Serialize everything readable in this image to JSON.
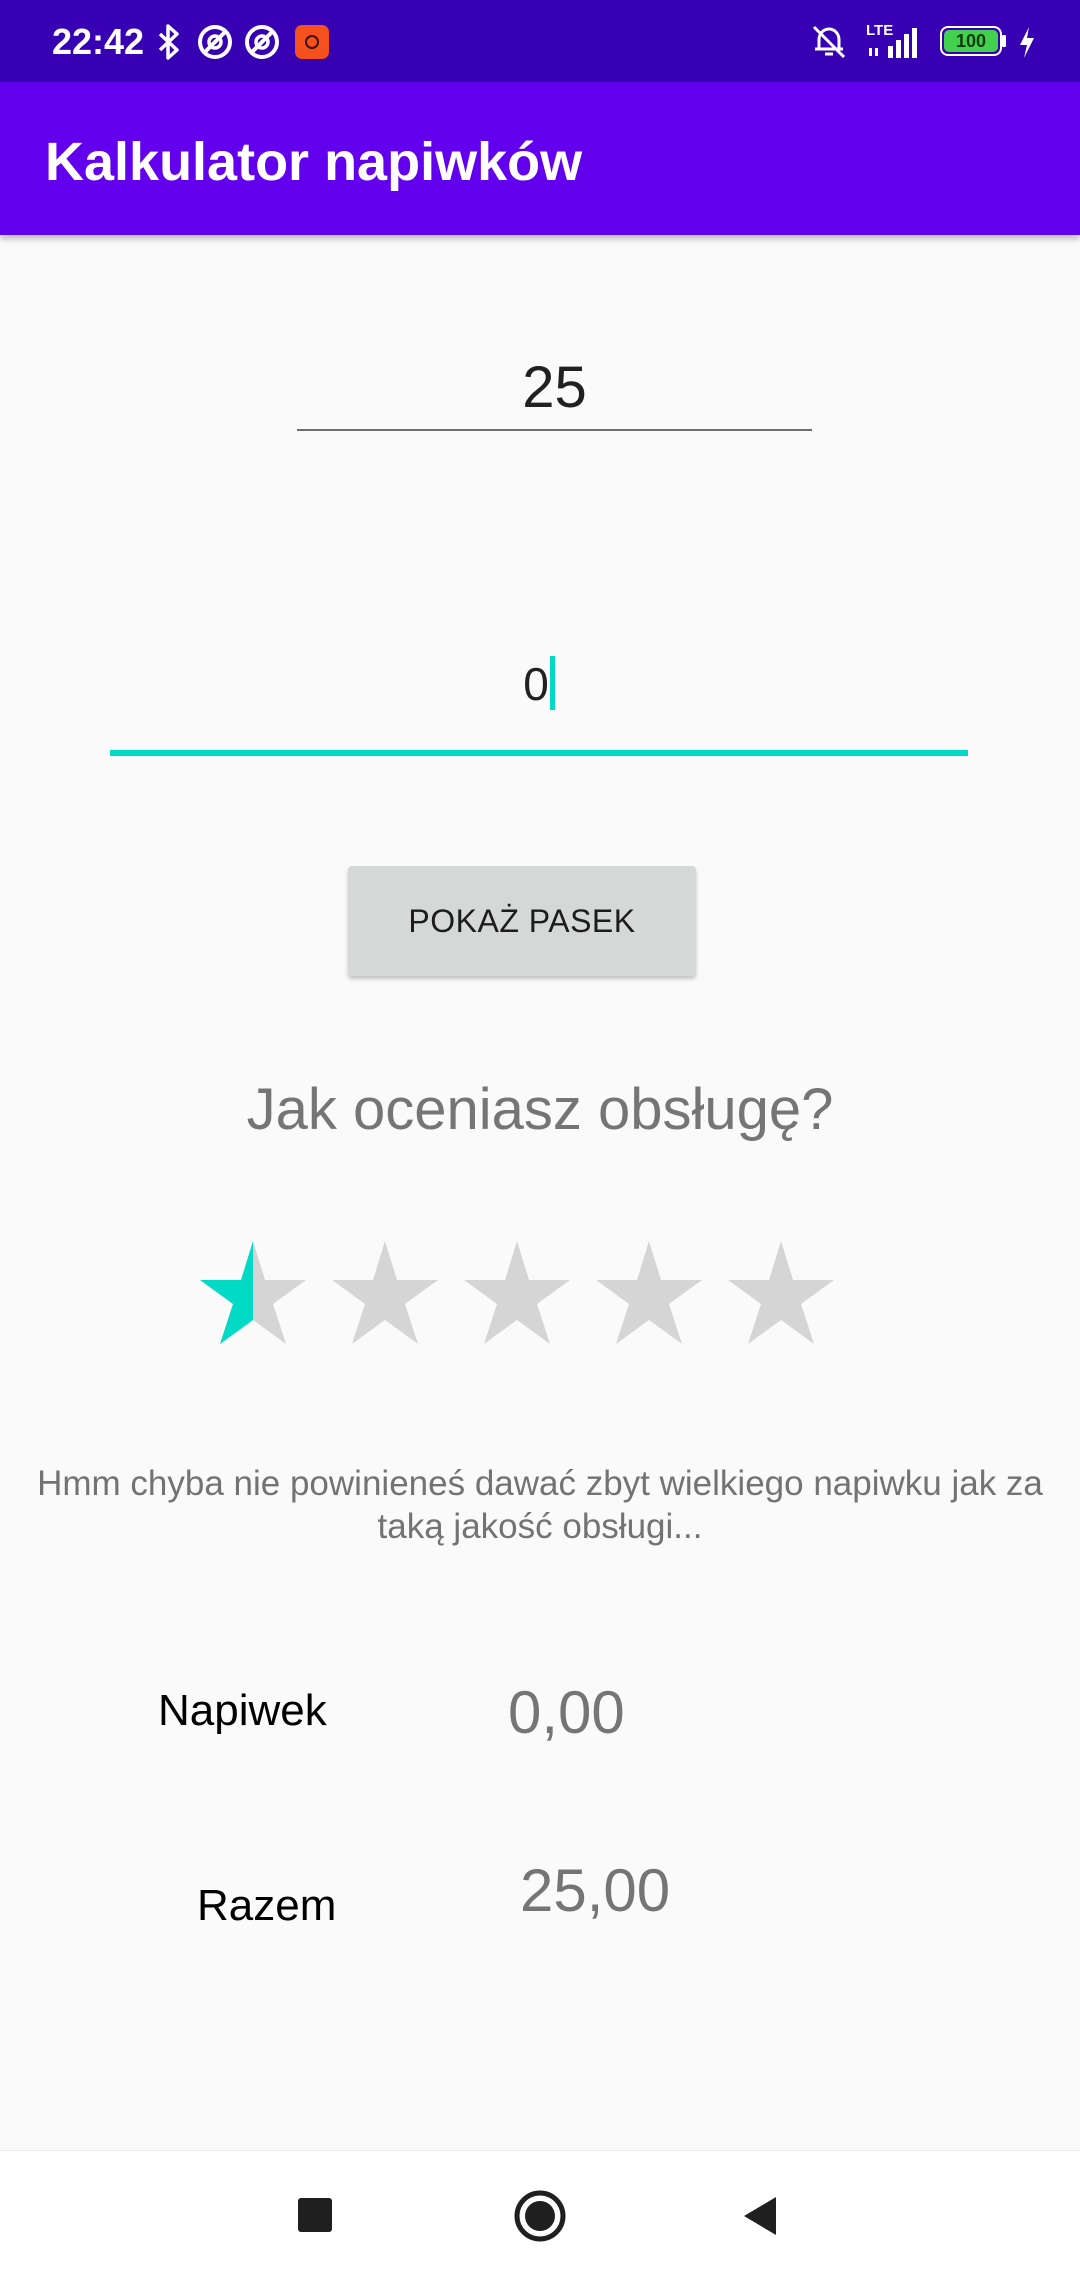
{
  "status_bar": {
    "time": "22:42",
    "network": "LTE",
    "battery": "100",
    "icons": [
      "bluetooth-icon",
      "do-not-disturb-icon",
      "do-not-disturb-icon",
      "app-notification-icon",
      "vibrate-off-icon",
      "signal-icon",
      "battery-icon",
      "charging-icon"
    ]
  },
  "app_bar": {
    "title": "Kalkulator napiwków"
  },
  "form": {
    "amount_value": "25",
    "tip_value": "0",
    "show_bar_button": "POKAŻ PASEK"
  },
  "rating": {
    "question": "Jak oceniasz obsługę?",
    "value": 0.5,
    "max": 5,
    "filled_color": "#03dac5",
    "empty_color": "#d5d5d5"
  },
  "hint": {
    "text": "Hmm chyba nie powinieneś dawać zbyt wielkiego napiwku jak za taką jakość obsługi..."
  },
  "results": {
    "tip_label": "Napiwek",
    "tip_value": "0,00",
    "total_label": "Razem",
    "total_value": "25,00"
  },
  "colors": {
    "status_bar": "#3700b3",
    "app_bar": "#6200ee",
    "accent": "#03dac5"
  },
  "nav_bar": {
    "icons": [
      "recents-icon",
      "home-icon",
      "back-icon"
    ]
  }
}
